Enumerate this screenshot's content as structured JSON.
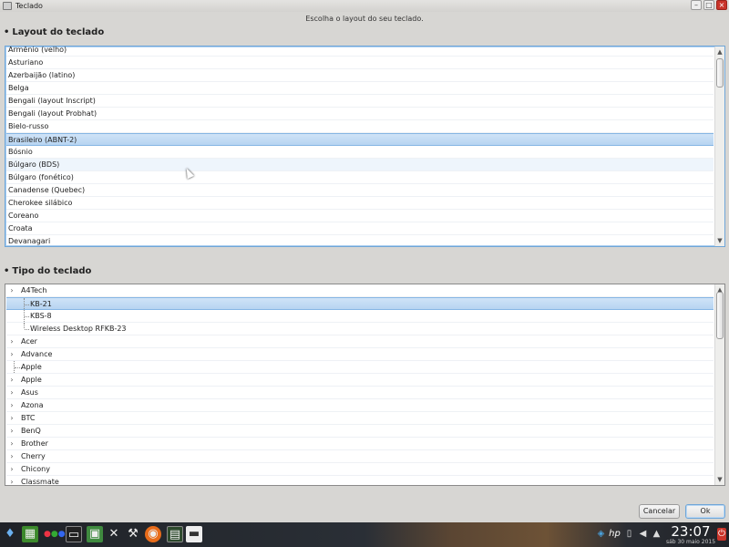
{
  "window": {
    "title": "Teclado"
  },
  "subtitle": "Escolha o layout do seu teclado.",
  "layout_section": {
    "title": "Layout do teclado",
    "items": [
      "Armênio (velho)",
      "Asturiano",
      "Azerbaijão (latino)",
      "Belga",
      "Bengali (layout Inscript)",
      "Bengali (layout Probhat)",
      "Bielo-russo",
      "Brasileiro (ABNT-2)",
      "Bósnio",
      "Búlgaro (BDS)",
      "Búlgaro (fonético)",
      "Canadense (Quebec)",
      "Cherokee silábico",
      "Coreano",
      "Croata",
      "Devanagari"
    ],
    "selected": "Brasileiro (ABNT-2)"
  },
  "type_section": {
    "title": "Tipo do teclado",
    "items": [
      {
        "label": "A4Tech",
        "level": 0,
        "expandable": true
      },
      {
        "label": "KB-21",
        "level": 1,
        "expandable": false
      },
      {
        "label": "KBS-8",
        "level": 1,
        "expandable": false
      },
      {
        "label": "Wireless Desktop RFKB-23",
        "level": 1,
        "expandable": false
      },
      {
        "label": "Acer",
        "level": 0,
        "expandable": true
      },
      {
        "label": "Advance",
        "level": 0,
        "expandable": true
      },
      {
        "label": "Apple",
        "level": 0,
        "expandable": false
      },
      {
        "label": "Apple",
        "level": 0,
        "expandable": true
      },
      {
        "label": "Asus",
        "level": 0,
        "expandable": true
      },
      {
        "label": "Azona",
        "level": 0,
        "expandable": true
      },
      {
        "label": "BTC",
        "level": 0,
        "expandable": true
      },
      {
        "label": "BenQ",
        "level": 0,
        "expandable": true
      },
      {
        "label": "Brother",
        "level": 0,
        "expandable": true
      },
      {
        "label": "Cherry",
        "level": 0,
        "expandable": true
      },
      {
        "label": "Chicony",
        "level": 0,
        "expandable": true
      },
      {
        "label": "Classmate",
        "level": 0,
        "expandable": true
      }
    ],
    "selected": "KB-21"
  },
  "buttons": {
    "cancel": "Cancelar",
    "ok": "Ok"
  },
  "taskbar": {
    "launchers": [
      "start-menu-icon",
      "game-icon",
      "dots-icon",
      "terminal-icon",
      "monitor-icon",
      "tools-icon",
      "settings-tools-icon",
      "firefox-icon",
      "system-monitor-icon",
      "drive-icon"
    ],
    "tray": [
      "network-icon",
      "hp-icon",
      "clipboard-icon",
      "volume-icon",
      "up-arrow-icon"
    ],
    "time": "23:07",
    "date": "sáb 30 maio 2015"
  },
  "colors": {
    "selection": "#b7d4f1",
    "focus_border": "#6fa6d8",
    "close_button": "#c9342a"
  }
}
